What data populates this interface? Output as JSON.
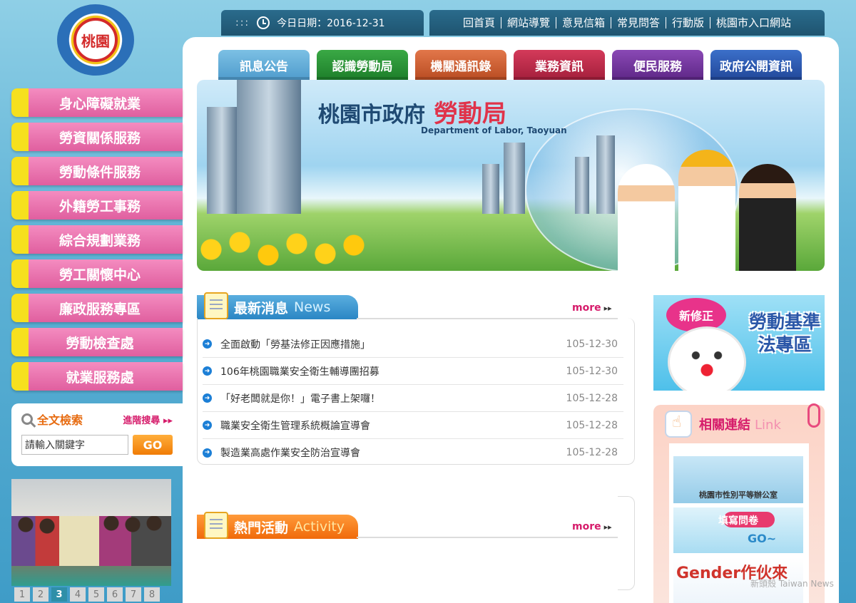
{
  "logo": {
    "text": "桃園"
  },
  "datebar": {
    "dots": ":::",
    "date_text": "今日日期：2016-12-31"
  },
  "toplinks": [
    "回首頁",
    "網站導覽",
    "意見信箱",
    "常見問答",
    "行動版",
    "桃園市入口網站"
  ],
  "tabs": [
    "訊息公告",
    "認識勞動局",
    "機關通訊錄",
    "業務資訊",
    "便民服務",
    "政府公開資訊"
  ],
  "banner": {
    "title": "桃園市政府",
    "title_red": "勞動局",
    "subtitle": "Department of Labor, Taoyuan"
  },
  "sidebar": [
    "身心障礙就業",
    "勞資關係服務",
    "勞動條件服務",
    "外籍勞工事務",
    "綜合規劃業務",
    "勞工關懷中心",
    "廉政服務專區",
    "勞動檢查處",
    "就業服務處"
  ],
  "search": {
    "title": "全文檢索",
    "advanced": "進階搜尋",
    "advanced_arrow": "▸▸",
    "input_value": "請輸入關鍵字",
    "go": "GO"
  },
  "pager": [
    "1",
    "2",
    "3",
    "4",
    "5",
    "6",
    "7",
    "8"
  ],
  "pager_active": "3",
  "news": {
    "title": "最新消息",
    "title_en": "News",
    "more": "more",
    "more_arrow": "▸▸",
    "items": [
      {
        "title": "全面啟動「勞基法修正因應措施」",
        "date": "105-12-30"
      },
      {
        "title": "106年桃園職業安全衛生輔導團招募",
        "date": "105-12-30"
      },
      {
        "title": "「好老闆就是你！」電子書上架囉！",
        "date": "105-12-28"
      },
      {
        "title": "職業安全衛生管理系統概論宣導會",
        "date": "105-12-28"
      },
      {
        "title": "製造業高處作業安全防治宣導會",
        "date": "105-12-28"
      }
    ]
  },
  "activity": {
    "title": "熱門活動",
    "title_en": "Activity",
    "more": "more",
    "more_arrow": "▸▸"
  },
  "promo": {
    "tag": "新修正",
    "title": "勞動基準法專區"
  },
  "links": {
    "title": "相關連結",
    "title_en": "Link",
    "card1": "桃園市性別平等辦公室",
    "card2": "填寫問卷",
    "card2_go": "GO~",
    "card3": "Gender作伙來"
  },
  "watermark": "新頭殼 Taiwan News",
  "colors": {
    "pink": "#e05f9f",
    "yellow": "#f6e01e",
    "accent_orange": "#f07c06",
    "news_blue": "#2b86c4",
    "link_pink": "#d61c6b"
  }
}
